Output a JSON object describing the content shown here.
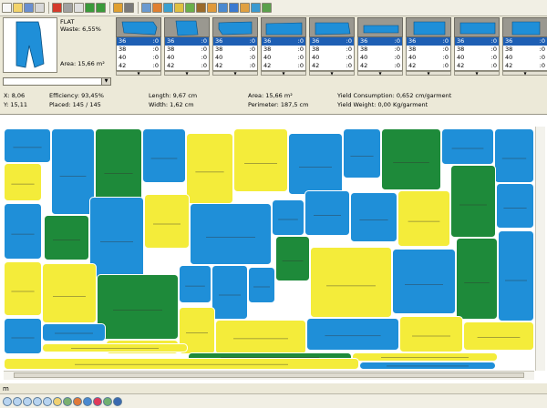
{
  "toolbar": {
    "buttons": [
      "new-icon",
      "open-icon",
      "save-icon",
      "print-icon",
      "close-icon",
      "cut-icon",
      "copy-icon",
      "undo-icon",
      "redo-icon",
      "magic-icon",
      "tools-icon",
      "align-icon",
      "rotate-icon",
      "flip-icon",
      "move-icon",
      "place-icon",
      "lock-icon",
      "home-icon",
      "export-icon",
      "import-icon",
      "stats-icon",
      "grid-icon",
      "check-icon"
    ]
  },
  "piece_info": {
    "name": "FLAT",
    "waste": "Waste: 6,55%",
    "area": "Area: 15,66 m²"
  },
  "piece_cards": [
    {
      "sizes": [
        [
          "36",
          ":0"
        ],
        [
          "38",
          ":0"
        ],
        [
          "40",
          ":0"
        ],
        [
          "42",
          ":0"
        ]
      ]
    },
    {
      "sizes": [
        [
          "36",
          ":0"
        ],
        [
          "38",
          ":0"
        ],
        [
          "40",
          ":0"
        ],
        [
          "42",
          ":0"
        ]
      ]
    },
    {
      "sizes": [
        [
          "36",
          ":0"
        ],
        [
          "38",
          ":0"
        ],
        [
          "40",
          ":0"
        ],
        [
          "42",
          ":0"
        ]
      ]
    },
    {
      "sizes": [
        [
          "36",
          ":0"
        ],
        [
          "38",
          ":0"
        ],
        [
          "40",
          ":0"
        ],
        [
          "42",
          ":0"
        ]
      ]
    },
    {
      "sizes": [
        [
          "36",
          ":0"
        ],
        [
          "38",
          ":0"
        ],
        [
          "40",
          ":0"
        ],
        [
          "42",
          ":0"
        ]
      ]
    },
    {
      "sizes": [
        [
          "36",
          ":0"
        ],
        [
          "38",
          ":0"
        ],
        [
          "40",
          ":0"
        ],
        [
          "42",
          ":0"
        ]
      ]
    },
    {
      "sizes": [
        [
          "36",
          ":0"
        ],
        [
          "38",
          ":0"
        ],
        [
          "40",
          ":0"
        ],
        [
          "42",
          ":0"
        ]
      ]
    },
    {
      "sizes": [
        [
          "36",
          ":0"
        ],
        [
          "38",
          ":0"
        ],
        [
          "40",
          ":0"
        ],
        [
          "42",
          ":0"
        ]
      ]
    },
    {
      "sizes": [
        [
          "36",
          ":0"
        ],
        [
          "38",
          ":0"
        ],
        [
          "40",
          ":0"
        ],
        [
          "42",
          ":0"
        ]
      ]
    }
  ],
  "stats": {
    "x": "X: 8,06",
    "y": "Y: 15,11",
    "efficiency": "Efficiency: 93,45%",
    "placed": "Placed: 145 / 145",
    "length": "Length: 9,67 cm",
    "width": "Width: 1,62 cm",
    "area": "Area: 15,66 m²",
    "perimeter": "Perimeter: 187,5 cm",
    "yield_consumption": "Yield Consumption: 0,652 cm/garment",
    "yield_weight": "Yield Weight: 0,00 Kg/garment"
  },
  "status": {
    "unit": "m"
  },
  "colors": {
    "blue": "#1f8fd8",
    "green": "#1e8a3a",
    "yellow": "#f4ec3a",
    "selected": "#1e5fb4"
  },
  "bottom_toolbar": {
    "buttons": [
      "zoom-in-icon",
      "zoom-out-icon",
      "zoom-fit-icon",
      "zoom-window-icon",
      "zoom-prev-icon",
      "measure-icon",
      "select-icon",
      "info-icon",
      "pieces-icon",
      "color-icon",
      "layers-icon",
      "grid-toggle-icon"
    ]
  }
}
